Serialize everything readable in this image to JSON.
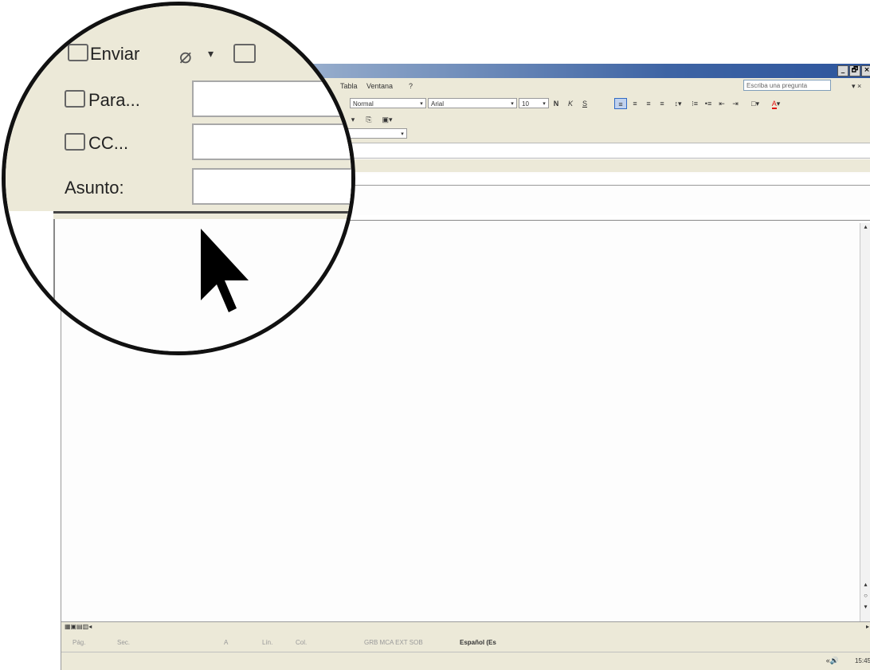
{
  "menu": {
    "items": [
      "Tabla",
      "Ventana",
      "?"
    ],
    "ask_placeholder": "Escriba una pregunta",
    "close_glyph": "▾ ×"
  },
  "window_buttons": {
    "min": "_",
    "max": "🗗",
    "close": "×"
  },
  "format_bar": {
    "style": "Normal",
    "font": "Arial",
    "size": "10",
    "bold": "N",
    "italic": "K",
    "underline": "S"
  },
  "address": {
    "send": "Enviar",
    "to": "Para...",
    "cc": "CC...",
    "subject": "Asunto:"
  },
  "status_bar": {
    "page": "Pág.",
    "section": "Sec.",
    "at": "A",
    "line": "Lín.",
    "col": "Col.",
    "flags": "GRB MCA EXT SOB",
    "language": "Español (Es"
  },
  "taskbar": {
    "clock": "15:45"
  },
  "icons": [
    "paperclip-icon",
    "address-book-icon",
    "arrow-cursor-icon",
    "chevron-down-icon"
  ],
  "colors": {
    "title_gradient_end": "#2d559d",
    "chrome": "#ece9d8",
    "font_color_accent": "#e01010"
  }
}
